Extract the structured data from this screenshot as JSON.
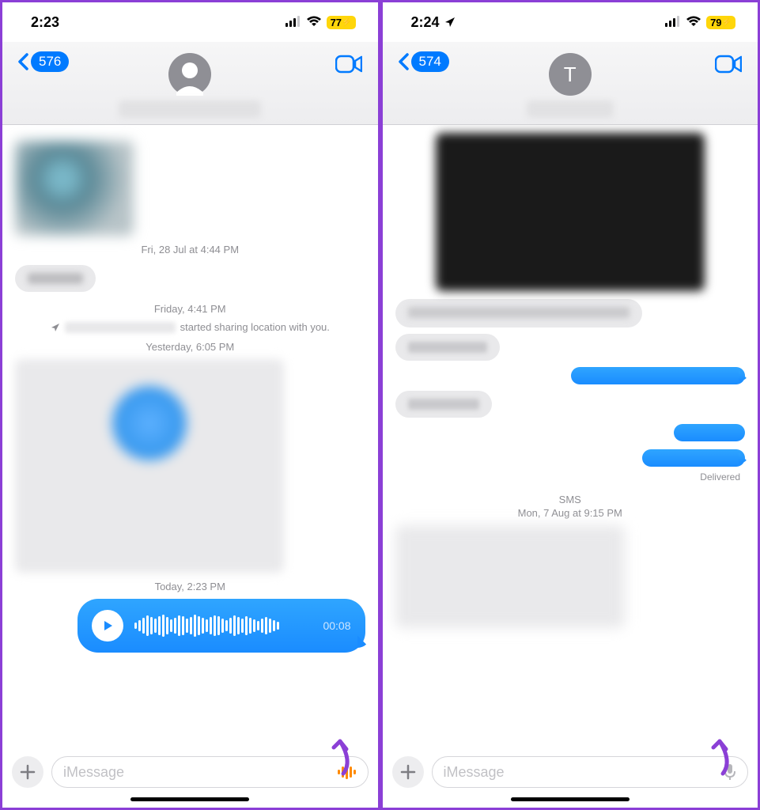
{
  "left": {
    "status": {
      "time": "2:23",
      "battery": "77",
      "charging": "⚡"
    },
    "header": {
      "back_count": "576"
    },
    "timestamps": {
      "t1_prefix": "Fri, 28 Jul",
      "t1_at": " at ",
      "t1_time": "4:44 PM",
      "t2_prefix": "Friday,",
      "t2_time": " 4:41 PM",
      "location_suffix": " started sharing location with you.",
      "t3_prefix": "Yesterday,",
      "t3_time": " 6:05 PM",
      "t4_prefix": "Today,",
      "t4_time": " 2:23 PM"
    },
    "audio": {
      "duration": "00:08"
    },
    "input": {
      "placeholder": "iMessage"
    }
  },
  "right": {
    "status": {
      "time": "2:24",
      "battery": "79",
      "charging": "⚡"
    },
    "header": {
      "back_count": "574",
      "avatar_initial": "T"
    },
    "delivered": "Delivered",
    "sms": {
      "label": "SMS",
      "date_prefix": "Mon, 7 Aug",
      "at": " at ",
      "time": "9:15 PM"
    },
    "input": {
      "placeholder": "iMessage"
    }
  }
}
